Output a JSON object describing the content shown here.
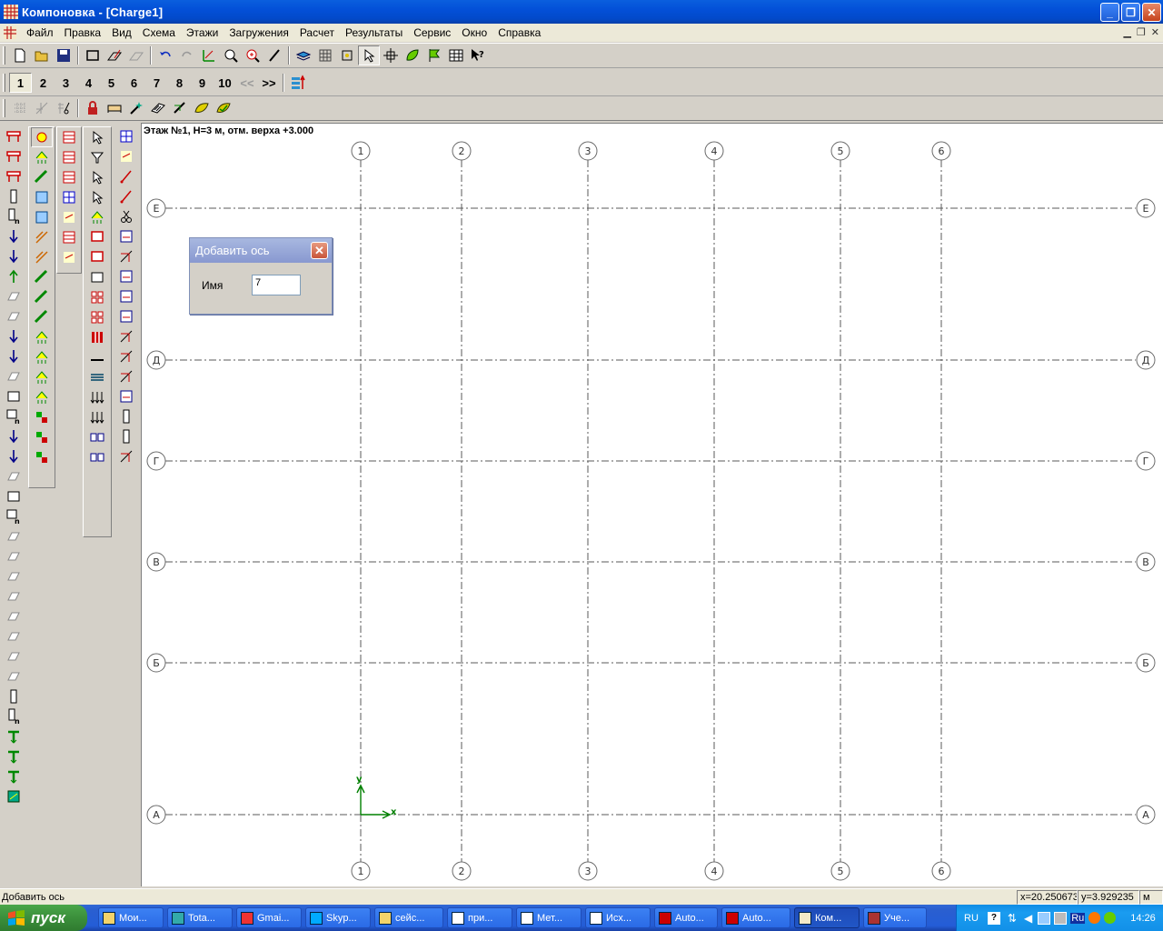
{
  "window": {
    "title": "Компоновка - [Charge1]"
  },
  "menu": {
    "items": [
      "Файл",
      "Правка",
      "Вид",
      "Схема",
      "Этажи",
      "Загружения",
      "Расчет",
      "Результаты",
      "Сервис",
      "Окно",
      "Справка"
    ]
  },
  "floors": {
    "buttons": [
      "1",
      "2",
      "3",
      "4",
      "5",
      "6",
      "7",
      "8",
      "9",
      "10"
    ],
    "prev": "<<",
    "next": ">>",
    "active": "1"
  },
  "canvas": {
    "floor_info": "Этаж №1, H=3 м, отм. верха +3.000",
    "vertical_axes": [
      "1",
      "2",
      "3",
      "4",
      "5",
      "6"
    ],
    "horizontal_axes": [
      "Е",
      "Д",
      "Г",
      "В",
      "Б",
      "А"
    ],
    "ucs": {
      "x_label": "x",
      "y_label": "y"
    }
  },
  "dialog": {
    "title": "Добавить ось",
    "name_label": "Имя",
    "name_value": "7"
  },
  "statusbar": {
    "text": "Добавить ось",
    "x": "x=20.250673",
    "y": "y=3.929235",
    "units": "м"
  },
  "taskbar": {
    "start": "пуск",
    "tasks": [
      "Мои...",
      "Tota...",
      "Gmai...",
      "Skyp...",
      "сейс...",
      "при...",
      "Мет...",
      "Исх...",
      "Auto...",
      "Auto...",
      "Ком...",
      "Уче..."
    ],
    "active_task": "Ком...",
    "lang": "RU",
    "lang2": "Ru",
    "clock": "14:26"
  },
  "colors": {
    "axis_line": "#5a5a5a",
    "ucs": "#008000",
    "titlebar": "#0350d8"
  }
}
